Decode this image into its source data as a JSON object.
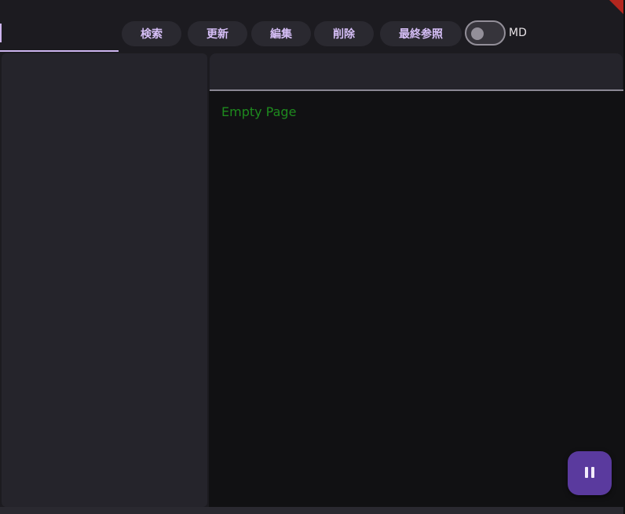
{
  "toolbar": {
    "search_value": "",
    "buttons": [
      {
        "label": "検索"
      },
      {
        "label": "更新"
      },
      {
        "label": "編集"
      },
      {
        "label": "削除"
      },
      {
        "label": "最終参照"
      }
    ],
    "md_toggle": {
      "label": "MD",
      "on": false
    }
  },
  "content": {
    "empty_message": "Empty Page"
  },
  "fab": {
    "icon": "pause-icon"
  },
  "colors": {
    "accent": "#cdb5ef",
    "button_text": "#d6bff7",
    "empty_text": "#1e8a1e",
    "fab_bg": "#5a3a9e",
    "flag": "#b3261e"
  }
}
